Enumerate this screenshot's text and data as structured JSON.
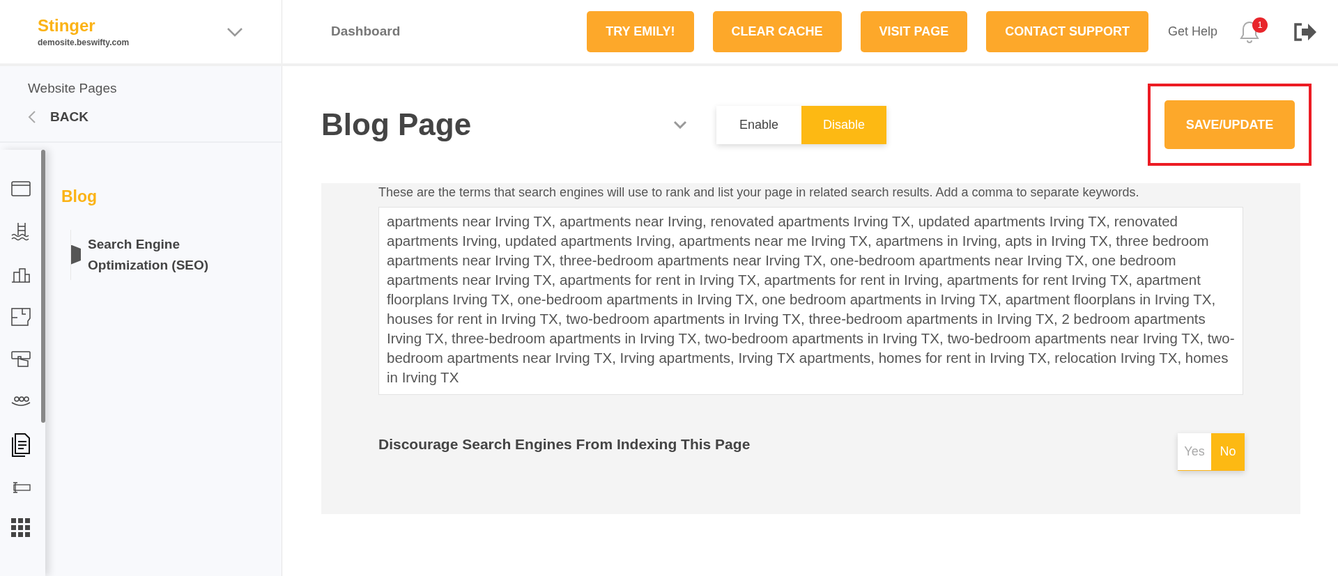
{
  "header": {
    "brand": "Stinger",
    "domain": "demosite.beswifty.com",
    "nav_link": "Dashboard",
    "buttons": [
      "TRY EMILY!",
      "CLEAR CACHE",
      "VISIT PAGE",
      "CONTACT SUPPORT"
    ],
    "help": "Get Help",
    "notification_count": "1"
  },
  "sidebar": {
    "heading": "Website Pages",
    "back": "BACK",
    "section": "Blog",
    "items": [
      {
        "label": "Search Engine Optimization (SEO)",
        "selected": true
      }
    ]
  },
  "page": {
    "title": "Blog Page",
    "status_options": [
      {
        "label": "Enable",
        "selected": false
      },
      {
        "label": "Disable",
        "selected": true
      }
    ],
    "save_button": "SAVE/UPDATE",
    "keywords_hint": "These are the terms that search engines will use to rank and list your page in related search results. Add a comma to separate keywords.",
    "keywords": "apartments near Irving TX, apartments near Irving, renovated apartments Irving TX, updated apartments Irving TX, renovated apartments Irving, updated apartments Irving, apartments near me Irving TX, apartmens in Irving, apts in Irving TX, three bedroom apartments near Irving TX, three-bedroom apartments near Irving TX, one-bedroom apartments near Irving TX, one bedroom apartments near Irving TX, apartments for rent in Irving TX, apartments for rent in Irving, apartments for rent Irving TX, apartment floorplans Irving TX, one-bedroom apartments in Irving TX, one bedroom apartments in Irving TX, apartment floorplans in Irving TX, houses for rent in Irving TX, two-bedroom apartments in Irving TX, three-bedroom apartments in Irving TX, 2 bedroom apartments Irving TX, three-bedroom apartments in Irving TX, two-bedroom apartments in Irving TX, two-bedroom apartments near Irving TX, two-bedroom apartments near Irving TX, Irving apartments, Irving TX apartments, homes for rent in Irving TX, relocation Irving TX, homes in Irving TX",
    "discourage": {
      "label": "Discourage Search Engines From Indexing This Page",
      "options": [
        {
          "label": "Yes",
          "selected": false
        },
        {
          "label": "No",
          "selected": true
        }
      ]
    }
  }
}
